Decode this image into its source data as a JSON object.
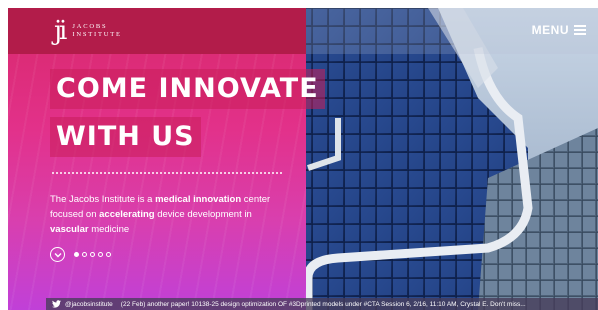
{
  "header": {
    "logo_mark": "ji",
    "logo_line1": "JACOBS",
    "logo_line2": "INSTITUTE",
    "menu_label": "MENU"
  },
  "hero": {
    "headline_line1": "COME INNOVATE",
    "headline_line2": "WITH US",
    "desc_part1": "The Jacobs Institute is a ",
    "desc_bold1": "medical innovation",
    "desc_part2": " center focused on ",
    "desc_bold2": "accelerating",
    "desc_part3": " device development in ",
    "desc_bold3": "vascular",
    "desc_part4": " medicine"
  },
  "slider": {
    "count": 5,
    "active_index": 0
  },
  "twitter": {
    "handle": "@jacobsinstitute",
    "tweet": "(22 Feb) another paper! 10138-25 design optimization OF #3Dprinted models under #CTA Session 6, 2/16, 11:10 AM, Crystal E. Don't miss..."
  },
  "colors": {
    "brand_pink": "#e2318a",
    "brand_dark": "#b21c4a",
    "purple": "#c040d8"
  },
  "icons": [
    "chevron-down-icon",
    "hamburger-icon",
    "twitter-icon"
  ]
}
